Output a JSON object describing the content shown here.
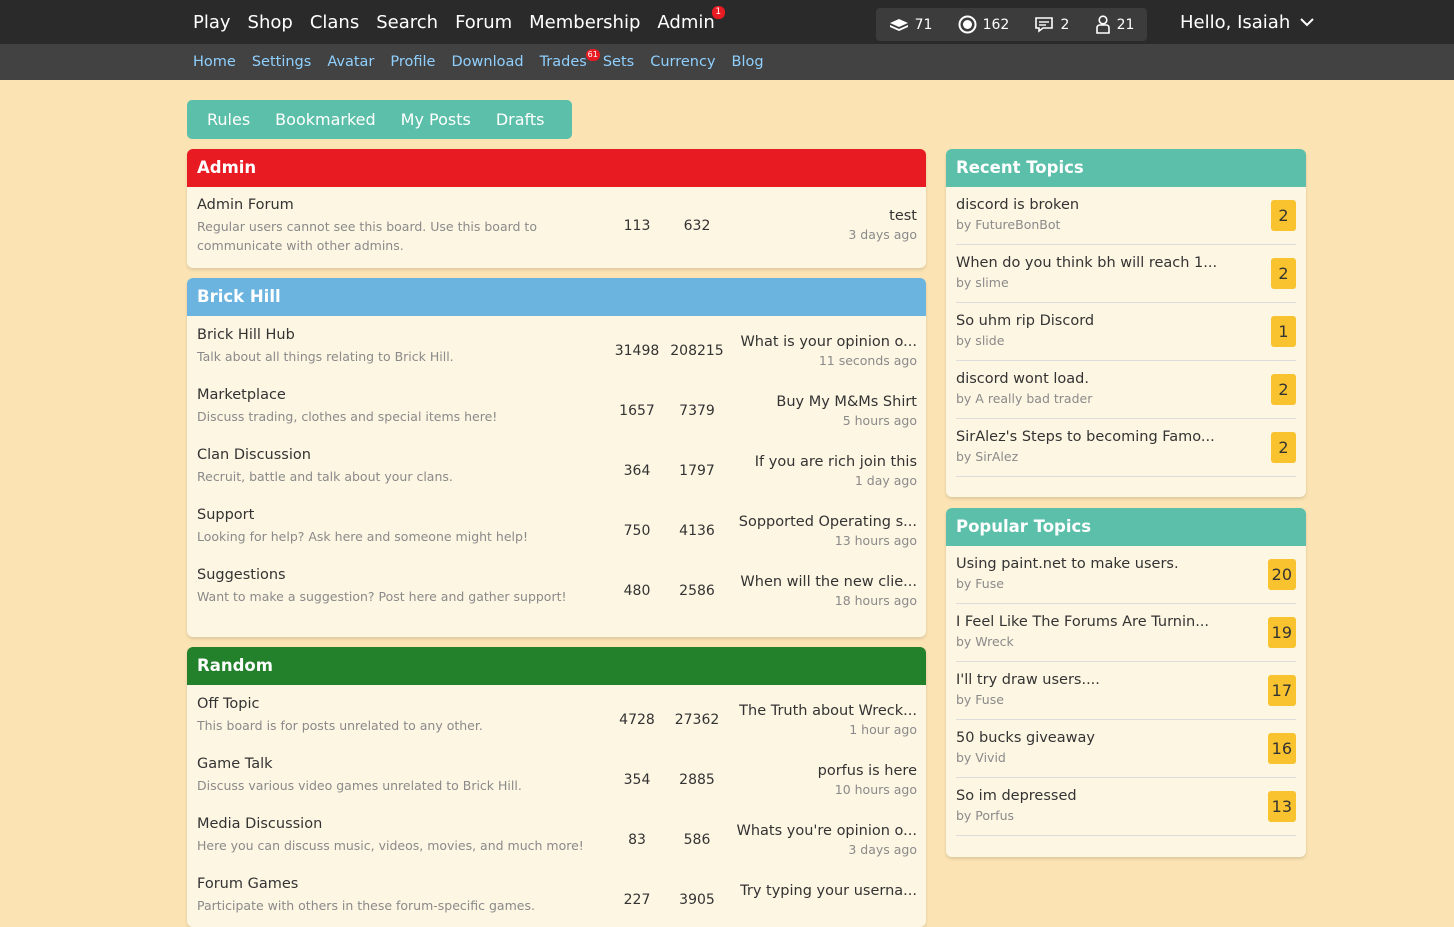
{
  "topnav": {
    "items": [
      "Play",
      "Shop",
      "Clans",
      "Search",
      "Forum",
      "Membership",
      "Admin"
    ],
    "admin_badge": "1",
    "stats": {
      "bucks": "71",
      "bits": "162",
      "messages": "2",
      "friends": "21"
    },
    "greeting": "Hello, Isaiah"
  },
  "subnav": {
    "items": [
      "Home",
      "Settings",
      "Avatar",
      "Profile",
      "Download",
      "Trades",
      "Sets",
      "Currency",
      "Blog"
    ],
    "trades_badge": "61"
  },
  "tabs": [
    "Rules",
    "Bookmarked",
    "My Posts",
    "Drafts"
  ],
  "colors": {
    "admin": "#e81b23",
    "brickhill": "#6cb4e0",
    "random": "#23812c",
    "teal": "#5cbfa9",
    "count": "#f8c32f"
  },
  "sections": [
    {
      "title": "Admin",
      "boards": [
        {
          "name": "Admin Forum",
          "desc": "Regular users cannot see this board. Use this board to communicate with other admins.",
          "topics": "113",
          "posts": "632",
          "last": "test",
          "ago": "3 days ago"
        }
      ]
    },
    {
      "title": "Brick Hill",
      "boards": [
        {
          "name": "Brick Hill Hub",
          "desc": "Talk about all things relating to Brick Hill.",
          "topics": "31498",
          "posts": "208215",
          "last": "What is your opinion o...",
          "ago": "11 seconds ago"
        },
        {
          "name": "Marketplace",
          "desc": "Discuss trading, clothes and special items here!",
          "topics": "1657",
          "posts": "7379",
          "last": "Buy My M&Ms Shirt",
          "ago": "5 hours ago"
        },
        {
          "name": "Clan Discussion",
          "desc": "Recruit, battle and talk about your clans.",
          "topics": "364",
          "posts": "1797",
          "last": "If you are rich join this",
          "ago": "1 day ago"
        },
        {
          "name": "Support",
          "desc": "Looking for help? Ask here and someone might help!",
          "topics": "750",
          "posts": "4136",
          "last": "Sopported Operating s...",
          "ago": "13 hours ago"
        },
        {
          "name": "Suggestions",
          "desc": "Want to make a suggestion? Post here and gather support!",
          "topics": "480",
          "posts": "2586",
          "last": "When will the new clie...",
          "ago": "18 hours ago"
        }
      ]
    },
    {
      "title": "Random",
      "boards": [
        {
          "name": "Off Topic",
          "desc": "This board is for posts unrelated to any other.",
          "topics": "4728",
          "posts": "27362",
          "last": "The Truth about Wreck...",
          "ago": "1 hour ago"
        },
        {
          "name": "Game Talk",
          "desc": "Discuss various video games unrelated to Brick Hill.",
          "topics": "354",
          "posts": "2885",
          "last": "porfus is here",
          "ago": "10 hours ago"
        },
        {
          "name": "Media Discussion",
          "desc": "Here you can discuss music, videos, movies, and much more!",
          "topics": "83",
          "posts": "586",
          "last": "Whats you're opinion o...",
          "ago": "3 days ago"
        },
        {
          "name": "Forum Games",
          "desc": "Participate with others in these forum-specific games.",
          "topics": "227",
          "posts": "3905",
          "last": "Try typing your userna...",
          "ago": ""
        }
      ]
    }
  ],
  "recent": {
    "title": "Recent Topics",
    "items": [
      {
        "title": "discord is broken",
        "by": "by FutureBonBot",
        "count": "2"
      },
      {
        "title": "When do you think bh will reach 1...",
        "by": "by slime",
        "count": "2"
      },
      {
        "title": "So uhm rip Discord",
        "by": "by slide",
        "count": "1"
      },
      {
        "title": "discord wont load.",
        "by": "by A really bad trader",
        "count": "2"
      },
      {
        "title": "SirAlez's Steps to becoming Famo...",
        "by": "by SirAlez",
        "count": "2"
      }
    ]
  },
  "popular": {
    "title": "Popular Topics",
    "items": [
      {
        "title": "Using paint.net to make users.",
        "by": "by Fuse",
        "count": "20"
      },
      {
        "title": "I Feel Like The Forums Are Turnin...",
        "by": "by Wreck",
        "count": "19"
      },
      {
        "title": "I'll try draw users....",
        "by": "by Fuse",
        "count": "17"
      },
      {
        "title": "50 bucks giveaway",
        "by": "by Vivid",
        "count": "16"
      },
      {
        "title": "So im depressed",
        "by": "by Porfus",
        "count": "13"
      }
    ]
  }
}
